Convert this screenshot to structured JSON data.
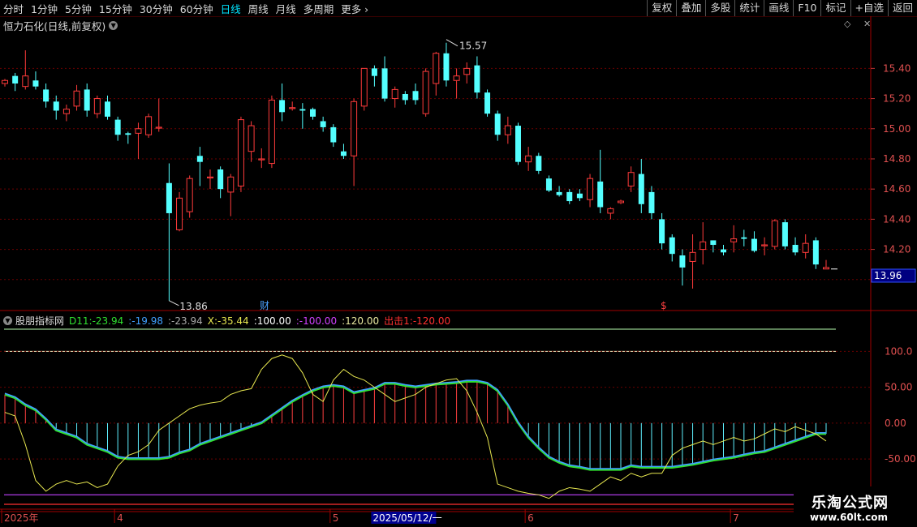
{
  "toolbar": {
    "periods": [
      "分时",
      "1分钟",
      "5分钟",
      "15分钟",
      "30分钟",
      "60分钟",
      "日线",
      "周线",
      "月线",
      "多周期",
      "更多"
    ],
    "active_index": 6,
    "right_buttons": [
      "复权",
      "叠加",
      "多股",
      "统计",
      "画线",
      "F10",
      "标记",
      "+自选",
      "返回"
    ]
  },
  "main": {
    "title": "恒力石化(日线,前复权)",
    "y_ticks": [
      15.4,
      15.2,
      15.0,
      14.8,
      14.6,
      14.4,
      14.2
    ],
    "y_range": [
      13.8,
      15.66
    ],
    "high_label": "15.57",
    "low_label": "13.86",
    "current_price": "13.96",
    "marker_cai": "财",
    "marker_s": "$"
  },
  "indicator": {
    "name": "股朋指标网",
    "d11_label": "D11:",
    "d11_value": "-23.94",
    "v2": ":-19.98",
    "v3": ":-23.94",
    "x_label": "X:",
    "x_value": "-35.44",
    "v4": ":100.00",
    "v5": ":-100.00",
    "v6": ":120.00",
    "exit_label": "出击1:",
    "exit_value": "-120.00",
    "y_ticks": [
      100.0,
      50.0,
      0.0,
      -50.0
    ],
    "y_tick_labels": [
      "100.0",
      "50.00",
      "0.00",
      "-50.00"
    ],
    "y_range": [
      -120,
      140
    ]
  },
  "time_axis": {
    "labels": [
      {
        "text": "2025年",
        "idx": 0
      },
      {
        "text": "4",
        "idx": 11
      },
      {
        "text": "5",
        "idx": 32
      },
      {
        "text": "2025/05/12/一",
        "idx": 36
      },
      {
        "text": "6",
        "idx": 51
      },
      {
        "text": "7",
        "idx": 71
      }
    ]
  },
  "logo": {
    "line1": "乐淘公式网",
    "line2": "www.60lt.com"
  },
  "chart_data": {
    "type": "candlestick",
    "candles": [
      [
        15.3,
        15.32,
        15.28,
        15.33
      ],
      [
        15.35,
        15.3,
        15.25,
        15.37
      ],
      [
        15.28,
        15.35,
        15.26,
        15.52
      ],
      [
        15.32,
        15.28,
        15.26,
        15.38
      ],
      [
        15.26,
        15.18,
        15.14,
        15.3
      ],
      [
        15.18,
        15.12,
        15.06,
        15.22
      ],
      [
        15.1,
        15.13,
        15.05,
        15.16
      ],
      [
        15.15,
        15.25,
        15.12,
        15.29
      ],
      [
        15.26,
        15.12,
        15.08,
        15.3
      ],
      [
        15.1,
        15.2,
        15.07,
        15.22
      ],
      [
        15.18,
        15.08,
        15.06,
        15.22
      ],
      [
        15.06,
        14.96,
        14.92,
        15.08
      ],
      [
        14.97,
        14.96,
        14.9,
        14.98
      ],
      [
        14.97,
        15.0,
        14.8,
        15.04
      ],
      [
        14.96,
        15.08,
        14.94,
        15.1
      ],
      [
        15.01,
        15.01,
        14.98,
        15.2
      ],
      [
        14.64,
        14.44,
        13.86,
        14.77
      ],
      [
        14.33,
        14.54,
        14.32,
        14.58
      ],
      [
        14.45,
        14.67,
        14.41,
        14.69
      ],
      [
        14.82,
        14.78,
        14.62,
        14.88
      ],
      [
        14.68,
        14.68,
        14.6,
        14.73
      ],
      [
        14.73,
        14.6,
        14.54,
        14.75
      ],
      [
        14.58,
        14.68,
        14.42,
        14.7
      ],
      [
        14.62,
        15.06,
        14.58,
        15.08
      ],
      [
        14.85,
        15.02,
        14.78,
        15.05
      ],
      [
        14.8,
        14.8,
        14.74,
        14.87
      ],
      [
        14.77,
        15.19,
        14.74,
        15.22
      ],
      [
        15.19,
        15.11,
        15.05,
        15.3
      ],
      [
        15.14,
        15.14,
        15.12,
        15.18
      ],
      [
        15.13,
        15.12,
        15.0,
        15.17
      ],
      [
        15.13,
        15.08,
        15.06,
        15.14
      ],
      [
        15.05,
        15.01,
        14.98,
        15.08
      ],
      [
        15.01,
        14.91,
        14.88,
        15.03
      ],
      [
        14.85,
        14.82,
        14.8,
        14.9
      ],
      [
        14.82,
        15.18,
        14.62,
        15.2
      ],
      [
        15.15,
        15.4,
        15.12,
        15.4
      ],
      [
        15.4,
        15.35,
        15.28,
        15.42
      ],
      [
        15.4,
        15.2,
        15.18,
        15.48
      ],
      [
        15.2,
        15.26,
        15.14,
        15.28
      ],
      [
        15.23,
        15.19,
        15.16,
        15.25
      ],
      [
        15.25,
        15.19,
        15.16,
        15.3
      ],
      [
        15.1,
        15.38,
        15.08,
        15.4
      ],
      [
        15.3,
        15.5,
        15.22,
        15.51
      ],
      [
        15.5,
        15.32,
        15.28,
        15.57
      ],
      [
        15.32,
        15.35,
        15.2,
        15.4
      ],
      [
        15.36,
        15.4,
        15.3,
        15.44
      ],
      [
        15.42,
        15.24,
        15.2,
        15.48
      ],
      [
        15.24,
        15.1,
        15.08,
        15.26
      ],
      [
        15.1,
        14.96,
        14.92,
        15.12
      ],
      [
        14.96,
        15.02,
        14.9,
        15.08
      ],
      [
        15.02,
        14.78,
        14.76,
        15.04
      ],
      [
        14.78,
        14.82,
        14.72,
        14.88
      ],
      [
        14.82,
        14.72,
        14.7,
        14.84
      ],
      [
        14.67,
        14.59,
        14.58,
        14.69
      ],
      [
        14.58,
        14.56,
        14.55,
        14.62
      ],
      [
        14.58,
        14.52,
        14.5,
        14.6
      ],
      [
        14.57,
        14.54,
        14.52,
        14.6
      ],
      [
        14.53,
        14.67,
        14.48,
        14.7
      ],
      [
        14.65,
        14.48,
        14.44,
        14.86
      ],
      [
        14.44,
        14.47,
        14.4,
        14.48
      ],
      [
        14.51,
        14.52,
        14.5,
        14.53
      ],
      [
        14.62,
        14.71,
        14.58,
        14.75
      ],
      [
        14.7,
        14.5,
        14.44,
        14.8
      ],
      [
        14.58,
        14.44,
        14.4,
        14.62
      ],
      [
        14.4,
        14.24,
        14.2,
        14.44
      ],
      [
        14.28,
        14.17,
        14.12,
        14.3
      ],
      [
        14.16,
        14.08,
        13.96,
        14.2
      ],
      [
        14.12,
        14.18,
        13.94,
        14.3
      ],
      [
        14.2,
        14.25,
        14.1,
        14.38
      ],
      [
        14.26,
        14.23,
        14.18,
        14.26
      ],
      [
        14.2,
        14.18,
        14.16,
        14.23
      ],
      [
        14.25,
        14.27,
        14.18,
        14.36
      ],
      [
        14.28,
        14.27,
        14.22,
        14.33
      ],
      [
        14.27,
        14.19,
        14.18,
        14.32
      ],
      [
        14.23,
        14.23,
        14.16,
        14.28
      ],
      [
        14.22,
        14.39,
        14.2,
        14.4
      ],
      [
        14.38,
        14.22,
        14.2,
        14.4
      ],
      [
        14.23,
        14.18,
        14.16,
        14.28
      ],
      [
        14.18,
        14.24,
        14.14,
        14.3
      ],
      [
        14.26,
        14.1,
        14.07,
        14.28
      ],
      [
        14.07,
        14.08,
        14.07,
        14.13
      ]
    ],
    "indicator_series": {
      "main": [
        40,
        35,
        25,
        18,
        5,
        -10,
        -15,
        -20,
        -30,
        -35,
        -40,
        -48,
        -50,
        -50,
        -50,
        -50,
        -48,
        -42,
        -38,
        -30,
        -25,
        -20,
        -15,
        -10,
        -5,
        0,
        10,
        20,
        30,
        38,
        45,
        50,
        52,
        50,
        42,
        45,
        48,
        55,
        55,
        52,
        50,
        52,
        54,
        55,
        56,
        58,
        58,
        55,
        45,
        25,
        0,
        -20,
        -35,
        -48,
        -55,
        -60,
        -62,
        -65,
        -65,
        -65,
        -65,
        -60,
        -62,
        -62,
        -62,
        -62,
        -60,
        -58,
        -55,
        -52,
        -50,
        -48,
        -45,
        -42,
        -40,
        -35,
        -30,
        -25,
        -20,
        -15,
        -15
      ],
      "x_line": [
        15,
        10,
        -30,
        -80,
        -95,
        -85,
        -80,
        -85,
        -82,
        -90,
        -85,
        -60,
        -45,
        -40,
        -30,
        -10,
        0,
        10,
        20,
        25,
        28,
        30,
        40,
        45,
        48,
        75,
        90,
        95,
        90,
        70,
        40,
        30,
        60,
        75,
        65,
        60,
        50,
        40,
        30,
        35,
        40,
        50,
        55,
        60,
        62,
        45,
        15,
        -20,
        -85,
        -90,
        -95,
        -98,
        -100,
        -105,
        -95,
        -90,
        -92,
        -95,
        -85,
        -75,
        -80,
        -70,
        -75,
        -70,
        -70,
        -45,
        -35,
        -30,
        -25,
        -30,
        -25,
        -20,
        -25,
        -22,
        -15,
        -8,
        -12,
        -5,
        -10,
        -15,
        -25
      ]
    }
  }
}
